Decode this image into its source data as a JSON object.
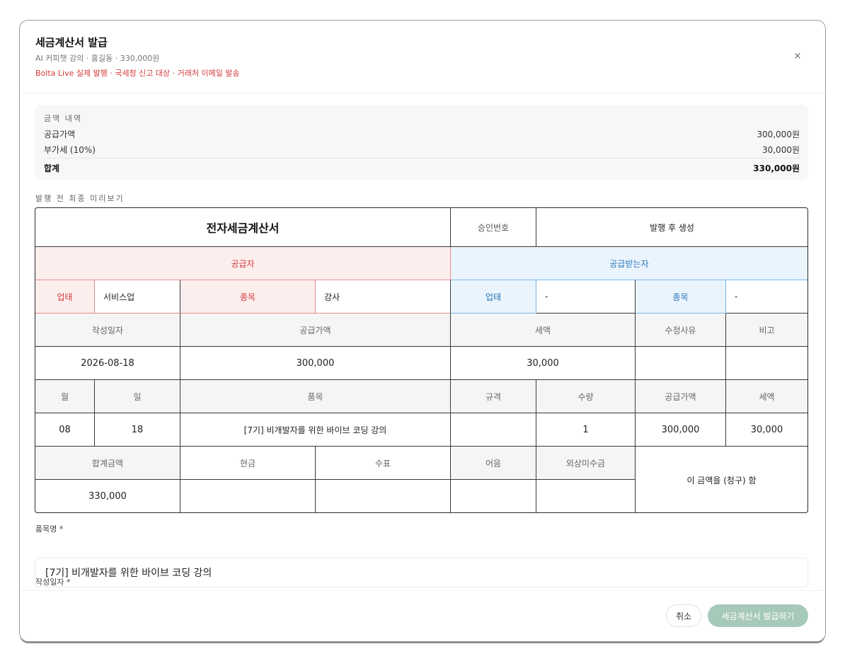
{
  "dialog": {
    "title": "세금계산서 발급",
    "subtitle": "AI 커피챗 강의 · 홍길동 · 330,000원",
    "warning": "Bolta Live 실제 발행 · 국세청 신고 대상 · 거래처 이메일 발송",
    "close_icon": "×"
  },
  "amounts": {
    "heading": "금액 내역",
    "supply_label": "공급가액",
    "supply_value": "300,000원",
    "vat_label": "부가세 (10%)",
    "vat_value": "30,000원",
    "total_label": "합계",
    "total_value": "330,000원"
  },
  "preview": {
    "label": "발행 전 최종 미리보기",
    "doc_title": "전자세금계산서",
    "approval_label": "승인번호",
    "approval_value": "발행 후 생성",
    "supplier_header": "공급자",
    "buyer_header": "공급받는자",
    "supplier": {
      "biz_type_label": "업태",
      "biz_type_value": "서비스업",
      "item_label": "종목",
      "item_value": "강사"
    },
    "buyer": {
      "biz_type_label": "업태",
      "biz_type_value": "-",
      "item_label": "종목",
      "item_value": "-"
    },
    "summary_headers": {
      "date": "작성일자",
      "supply": "공급가액",
      "tax": "세액",
      "reason": "수정사유",
      "note": "비고"
    },
    "summary_values": {
      "date": "2026-08-18",
      "supply": "300,000",
      "tax": "30,000",
      "reason": "",
      "note": ""
    },
    "item_headers": {
      "month": "월",
      "day": "일",
      "item": "품목",
      "spec": "규격",
      "qty": "수량",
      "supply": "공급가액",
      "tax": "세액"
    },
    "item_values": {
      "month": "08",
      "day": "18",
      "item": "[7기] 비개발자를 위한 바이브 코딩 강의",
      "spec": "",
      "qty": "1",
      "supply": "300,000",
      "tax": "30,000"
    },
    "payment_headers": {
      "total": "합계금액",
      "cash": "현금",
      "check": "수표",
      "bill": "어음",
      "credit": "외상미수금"
    },
    "payment_values": {
      "total": "330,000",
      "cash": "",
      "check": "",
      "bill": "",
      "credit": ""
    },
    "claim_text": "이 금액을 (청구) 함"
  },
  "form": {
    "item_name_label": "품목명 *",
    "item_name_value": "[7기] 비개발자를 위한 바이브 코딩 강의",
    "date_label": "작성일자 *"
  },
  "footer": {
    "cancel_label": "취소",
    "issue_label": "세금계산서 발급하기"
  },
  "colors": {
    "warning": "#d63a3a",
    "supplier_bg": "#fdeeee",
    "buyer_bg": "#eaf4fc",
    "buyer_text": "#2a74b8",
    "issue_button": "#a7c9b9"
  }
}
